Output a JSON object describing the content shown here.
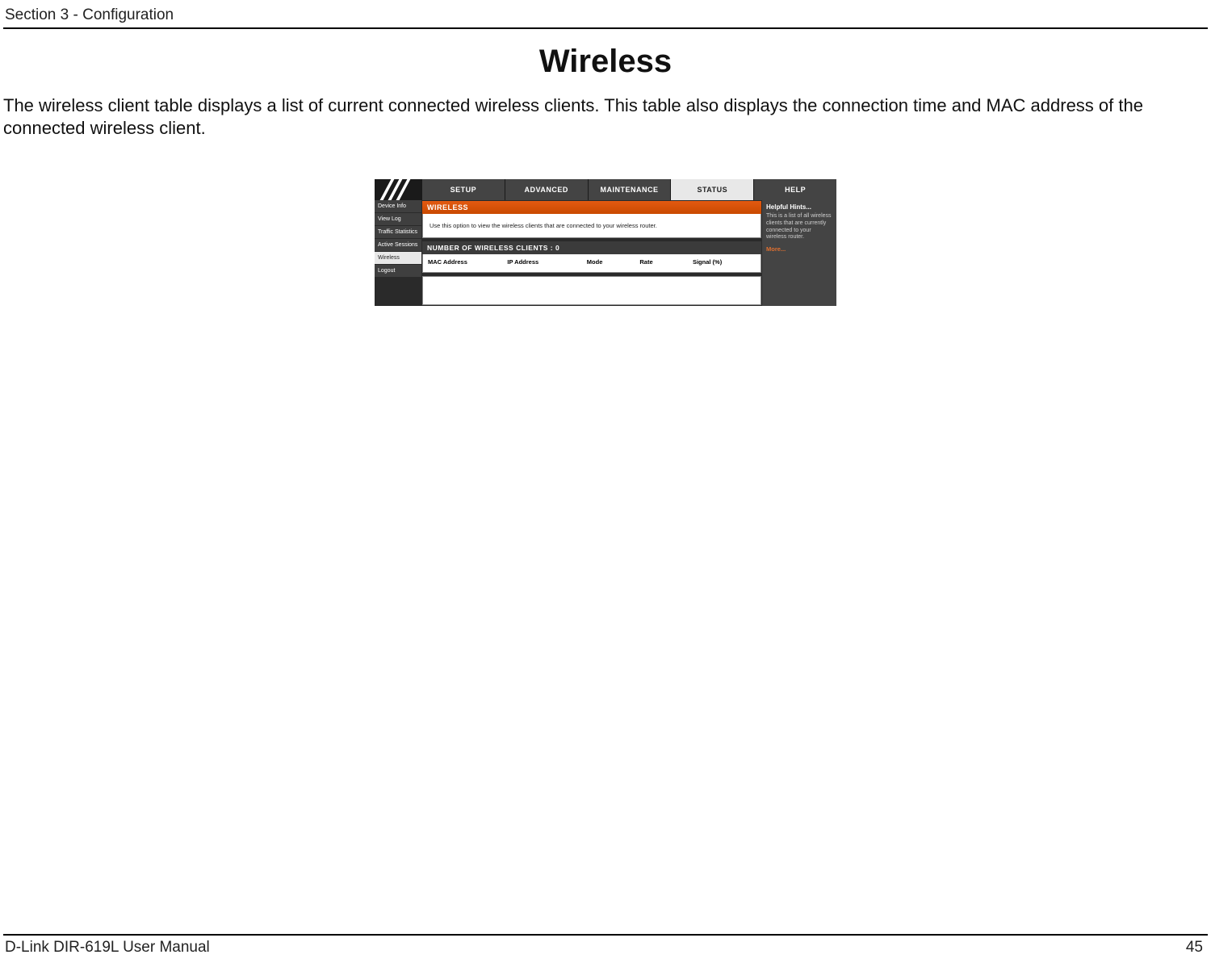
{
  "doc": {
    "section_header": "Section 3 - Configuration",
    "page_title": "Wireless",
    "intro": "The wireless client table displays a list of current connected wireless clients. This table also displays the connection time and MAC address of the connected wireless client.",
    "footer_left": "D-Link DIR-619L User Manual",
    "footer_right": "45"
  },
  "router": {
    "tabs": {
      "setup": "SETUP",
      "advanced": "ADVANCED",
      "maintenance": "MAINTENANCE",
      "status": "STATUS",
      "help": "HELP"
    },
    "sidebar": {
      "device_info": "Device Info",
      "view_log": "View Log",
      "traffic_stats": "Traffic Statistics",
      "active_sessions": "Active Sessions",
      "wireless": "Wireless",
      "logout": "Logout"
    },
    "panel": {
      "heading": "WIRELESS",
      "text": "Use this option to view the wireless clients that are connected to your wireless router.",
      "clients_heading": "NUMBER OF WIRELESS CLIENTS :  0"
    },
    "table": {
      "mac": "MAC Address",
      "ip": "IP Address",
      "mode": "Mode",
      "rate": "Rate",
      "signal": "Signal (%)"
    },
    "hints": {
      "title": "Helpful Hints...",
      "text": "This is a list of all wireless clients that are currently connected to your wireless router.",
      "more": "More..."
    }
  }
}
